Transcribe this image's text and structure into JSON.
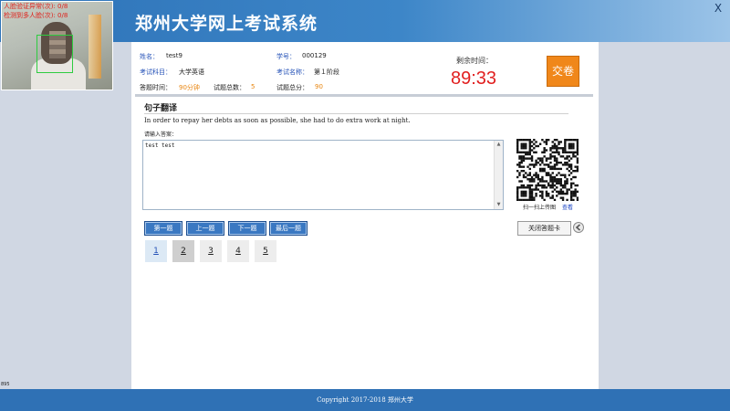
{
  "header": {
    "title": "郑州大学网上考试系统",
    "close_label": "X"
  },
  "webcam": {
    "status_line_1": "人脸验证异常(次): 0/8",
    "status_line_2": "检测到多人脸(次): 0/8"
  },
  "exam_info": {
    "name_label": "姓名：",
    "name_value": "test9",
    "student_id_label": "学号：",
    "student_id_value": "000129",
    "subject_label": "考试科目：",
    "subject_value": "大学英语",
    "exam_name_label": "考试名称：",
    "exam_name_value": "第１阶段",
    "duration_label": "答题时间：",
    "duration_value": "90分钟",
    "total_questions_label": "试题总数：",
    "total_questions_value": "5",
    "total_score_label": "试题总分：",
    "total_score_value": "90"
  },
  "timer": {
    "label": "剩余时间：",
    "value": "89:33"
  },
  "submit_button": {
    "label": "交卷"
  },
  "question": {
    "section_title": "句子翻译",
    "text": "In order to repay her debts as soon as possible, she had to do extra work at night.",
    "answer_label": "请输入答案：",
    "answer_value": "test test"
  },
  "qr": {
    "caption": "扫一扫上传图",
    "link_label": "查看"
  },
  "navigation": {
    "first": "第一题",
    "prev": "上一题",
    "next": "下一题",
    "last": "最后一题",
    "answer_card": "关闭答题卡"
  },
  "question_numbers": [
    "1",
    "2",
    "3",
    "4",
    "5"
  ],
  "corner_text": "895",
  "footer": {
    "text": "Copyright 2017-2018 郑州大学"
  }
}
